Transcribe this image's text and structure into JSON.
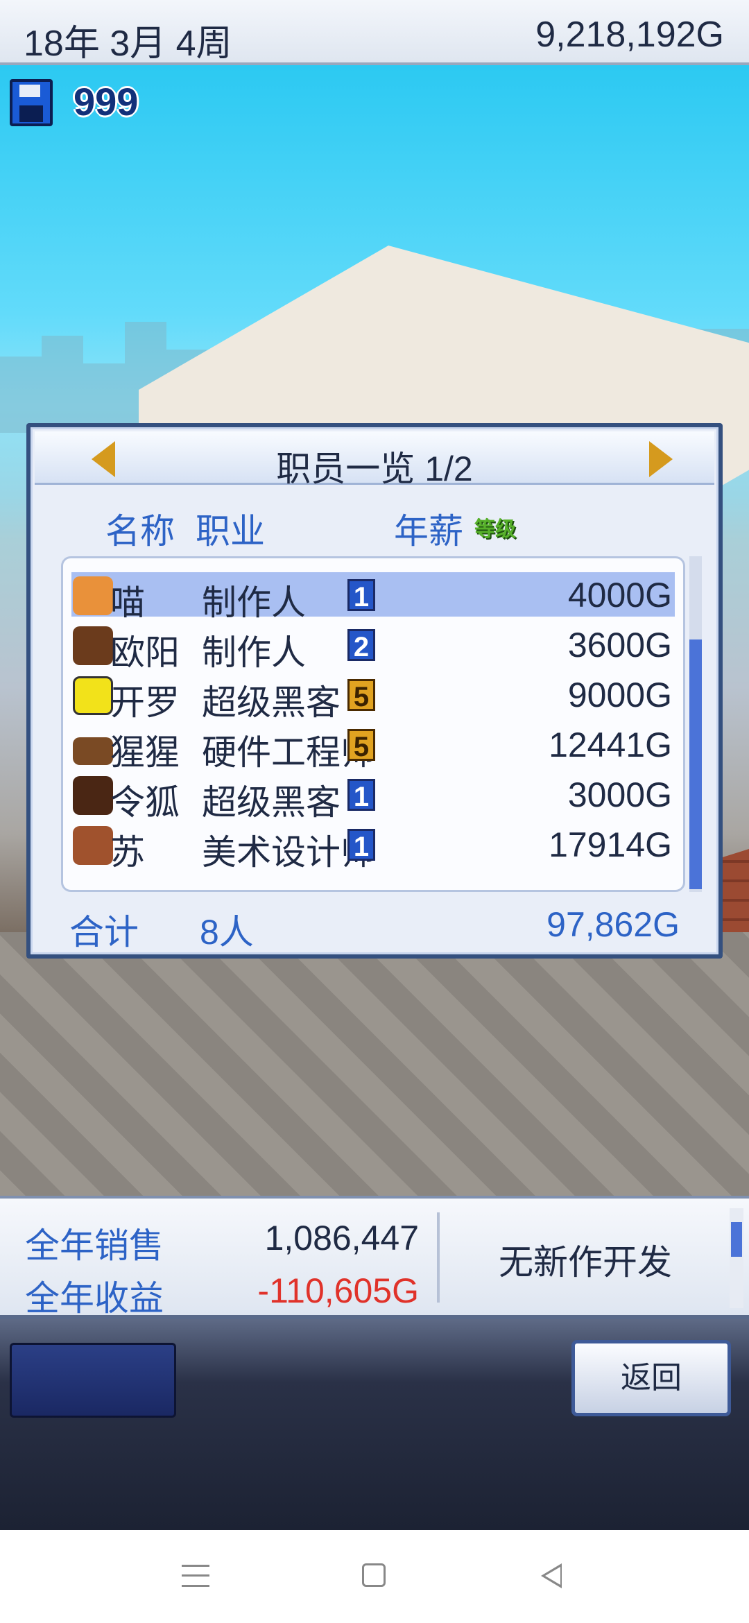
{
  "topbar": {
    "date": "18年 3月 4周",
    "money": "9,218,192G"
  },
  "save": {
    "icon": "floppy-disk-icon",
    "count": "999"
  },
  "panel": {
    "title": "职员一览 1/2",
    "columns": {
      "name": "名称",
      "job": "职业",
      "level": "等级",
      "salary": "年薪"
    },
    "rows": [
      {
        "name": "喵",
        "job": "制作人",
        "level": "1",
        "level_style": "blue",
        "salary": "4000G",
        "selected": true,
        "avatar": "cat-avatar-icon"
      },
      {
        "name": "欧阳",
        "job": "制作人",
        "level": "2",
        "level_style": "blue",
        "salary": "3600G",
        "avatar": "man-avatar-icon"
      },
      {
        "name": "开罗",
        "job": "超级黑客",
        "level": "5",
        "level_style": "gold",
        "salary": "9000G",
        "avatar": "yellow-box-avatar-icon"
      },
      {
        "name": "猩猩",
        "job": "硬件工程师",
        "level": "5",
        "level_style": "gold",
        "salary": "12441G",
        "avatar": "gorilla-avatar-icon"
      },
      {
        "name": "令狐",
        "job": "超级黑客",
        "level": "1",
        "level_style": "blue",
        "salary": "3000G",
        "avatar": "woman-avatar-icon"
      },
      {
        "name": "苏",
        "job": "美术设计师",
        "level": "1",
        "level_style": "blue",
        "salary": "17914G",
        "avatar": "girl-avatar-icon"
      }
    ],
    "total": {
      "label": "合计",
      "count": "8人",
      "salary": "97,862G"
    }
  },
  "info": {
    "sales_label": "全年销售",
    "sales_value": "1,086,447",
    "profit_label": "全年收益",
    "profit_value": "-110,605G",
    "status": "无新作开发"
  },
  "buttons": {
    "back": "返回"
  }
}
